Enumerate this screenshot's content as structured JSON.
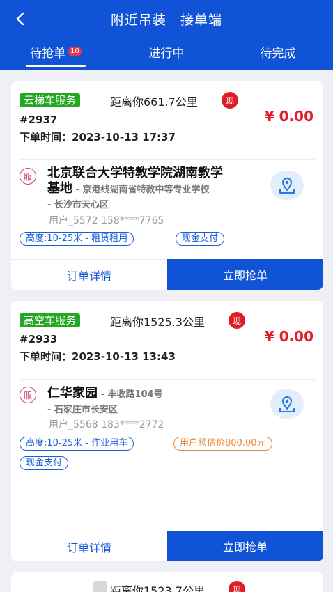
{
  "header": {
    "title": "附近吊装｜接单端",
    "tabs": [
      {
        "label": "待抢单",
        "badge": "10"
      },
      {
        "label": "进行中"
      },
      {
        "label": "待完成"
      }
    ]
  },
  "colors": {
    "primary": "#1053d6",
    "service_tag": "#24a824",
    "price": "#e01d25",
    "cash_badge": "#e01d25"
  },
  "orders": [
    {
      "service": "云梯车服务",
      "distance": "距离你661.7公里",
      "cash_badge": "现",
      "order_no": "#2937",
      "order_time": "下单时间：2023-10-13 17:37",
      "price": "¥ 0.00",
      "service_icon": "服",
      "place_name_line1": "北京联合大学特教学院湖南教学",
      "place_name_line2": "基地",
      "place_sub_line1": " - 京港线湖南省特教中等专业学校",
      "place_sub_line2": "- 长沙市天心区",
      "user": "用户_5572   158****7765",
      "tags": [
        "高度:10-25米 - 租赁租用",
        "现金支付"
      ],
      "detail_label": "订单详情",
      "grab_label": "立即抢单"
    },
    {
      "service": "高空车服务",
      "distance": "距离你1525.3公里",
      "cash_badge": "现",
      "order_no": "#2933",
      "order_time": "下单时间：2023-10-13 13:43",
      "price": "¥ 0.00",
      "service_icon": "服",
      "place_name_line1": "仁华家园",
      "place_sub_line1": " - 丰收路104号",
      "place_sub_line2": "- 石家庄市长安区",
      "user": "用户_5568   183****2772",
      "tags": [
        "高度:10-25米 - 作业用车",
        "用户预估价800.00元",
        "现金支付"
      ],
      "detail_label": "订单详情",
      "grab_label": "立即抢单"
    },
    {
      "distance": "距离你1523.7公里",
      "cash_badge": "现"
    }
  ]
}
